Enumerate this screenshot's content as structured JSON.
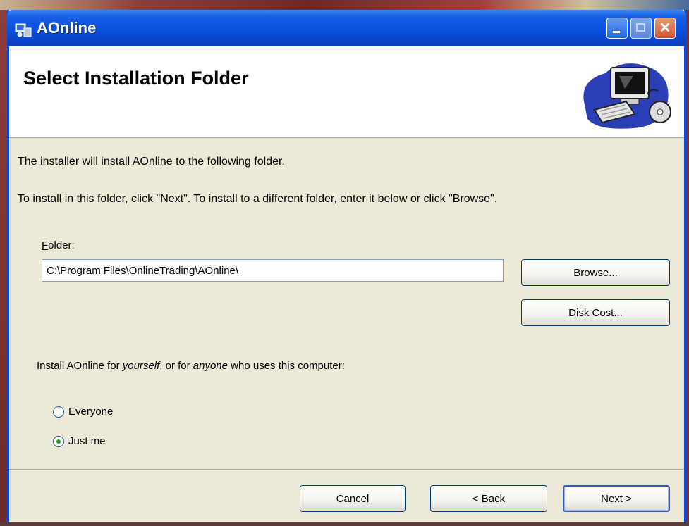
{
  "window": {
    "title": "AOnline",
    "close_glyph": "✕"
  },
  "header": {
    "title": "Select Installation Folder",
    "graphic_icon": "computer-setup-icon"
  },
  "body": {
    "line1": "The installer will install AOnline to the following folder.",
    "line2": "To install in this folder, click \"Next\". To install to a different folder, enter it below or click \"Browse\".",
    "folder_label_key": "F",
    "folder_label_rest": "older:",
    "folder_value": "C:\\Program Files\\OnlineTrading\\AOnline\\",
    "browse_label": "Browse...",
    "disk_cost_label": "Disk Cost...",
    "install_for_label_pre": "Install AOnline for ",
    "install_for_label_em1": "yourself",
    "install_for_label_mid": ", or for ",
    "install_for_label_em2": "anyone",
    "install_for_label_post": " who uses this computer:",
    "radio_everyone": "Everyone",
    "radio_justme": "Just me",
    "selected": "Just me"
  },
  "footer": {
    "cancel_label": "Cancel",
    "back_label": "< Back",
    "next_label": "Next >"
  },
  "colors": {
    "titlebar": "#0a53e0",
    "dialog_bg": "#ece9d8",
    "header_bg": "#ffffff"
  }
}
